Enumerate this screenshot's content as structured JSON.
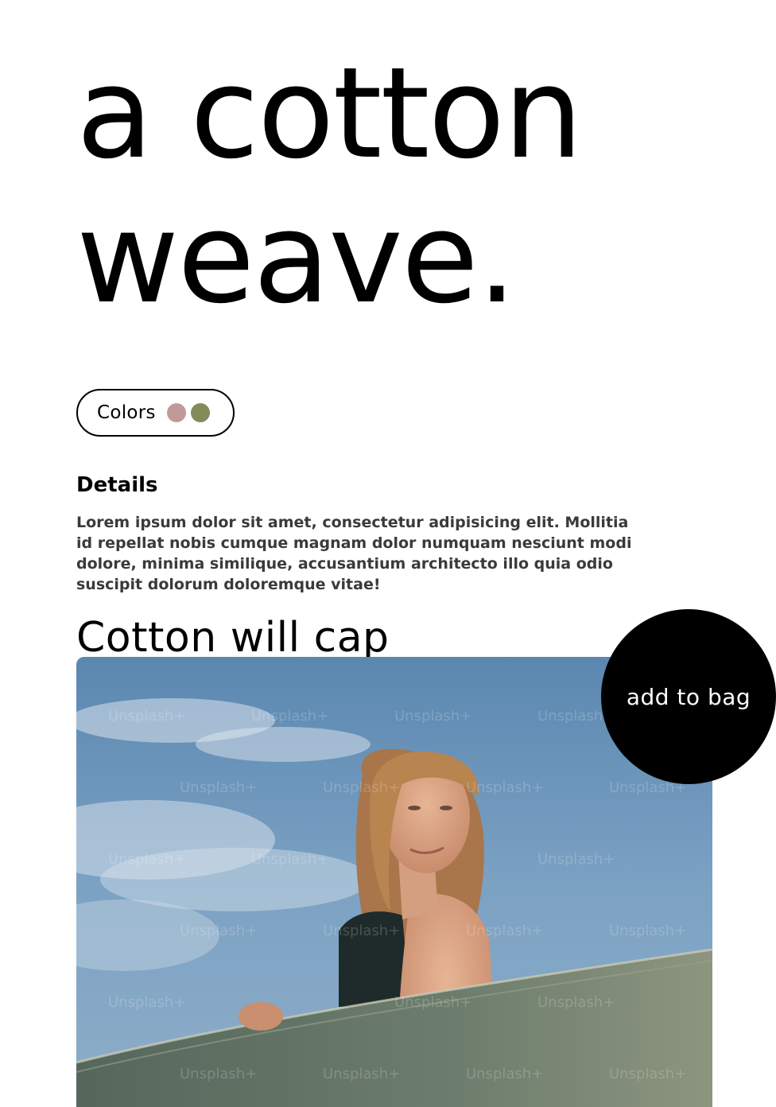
{
  "hero": {
    "line1": "a cotton",
    "line2": "weave."
  },
  "colors": {
    "label": "Colors",
    "swatches": [
      "#c09a99",
      "#848a5a"
    ]
  },
  "details": {
    "heading": "Details",
    "body": "Lorem ipsum dolor sit amet, consectetur adipisicing elit. Mollitia id repellat nobis cumque magnam dolor numquam nesciunt modi dolore, minima similique, accusantium architecto illo quia odio suscipit dolorum doloremque vitae!"
  },
  "product": {
    "title": "Cotton will cap",
    "image_alt": "Woman holding a surfboard under a blue sky",
    "watermark": "Unsplash+"
  },
  "cta": {
    "label": "add to bag"
  }
}
